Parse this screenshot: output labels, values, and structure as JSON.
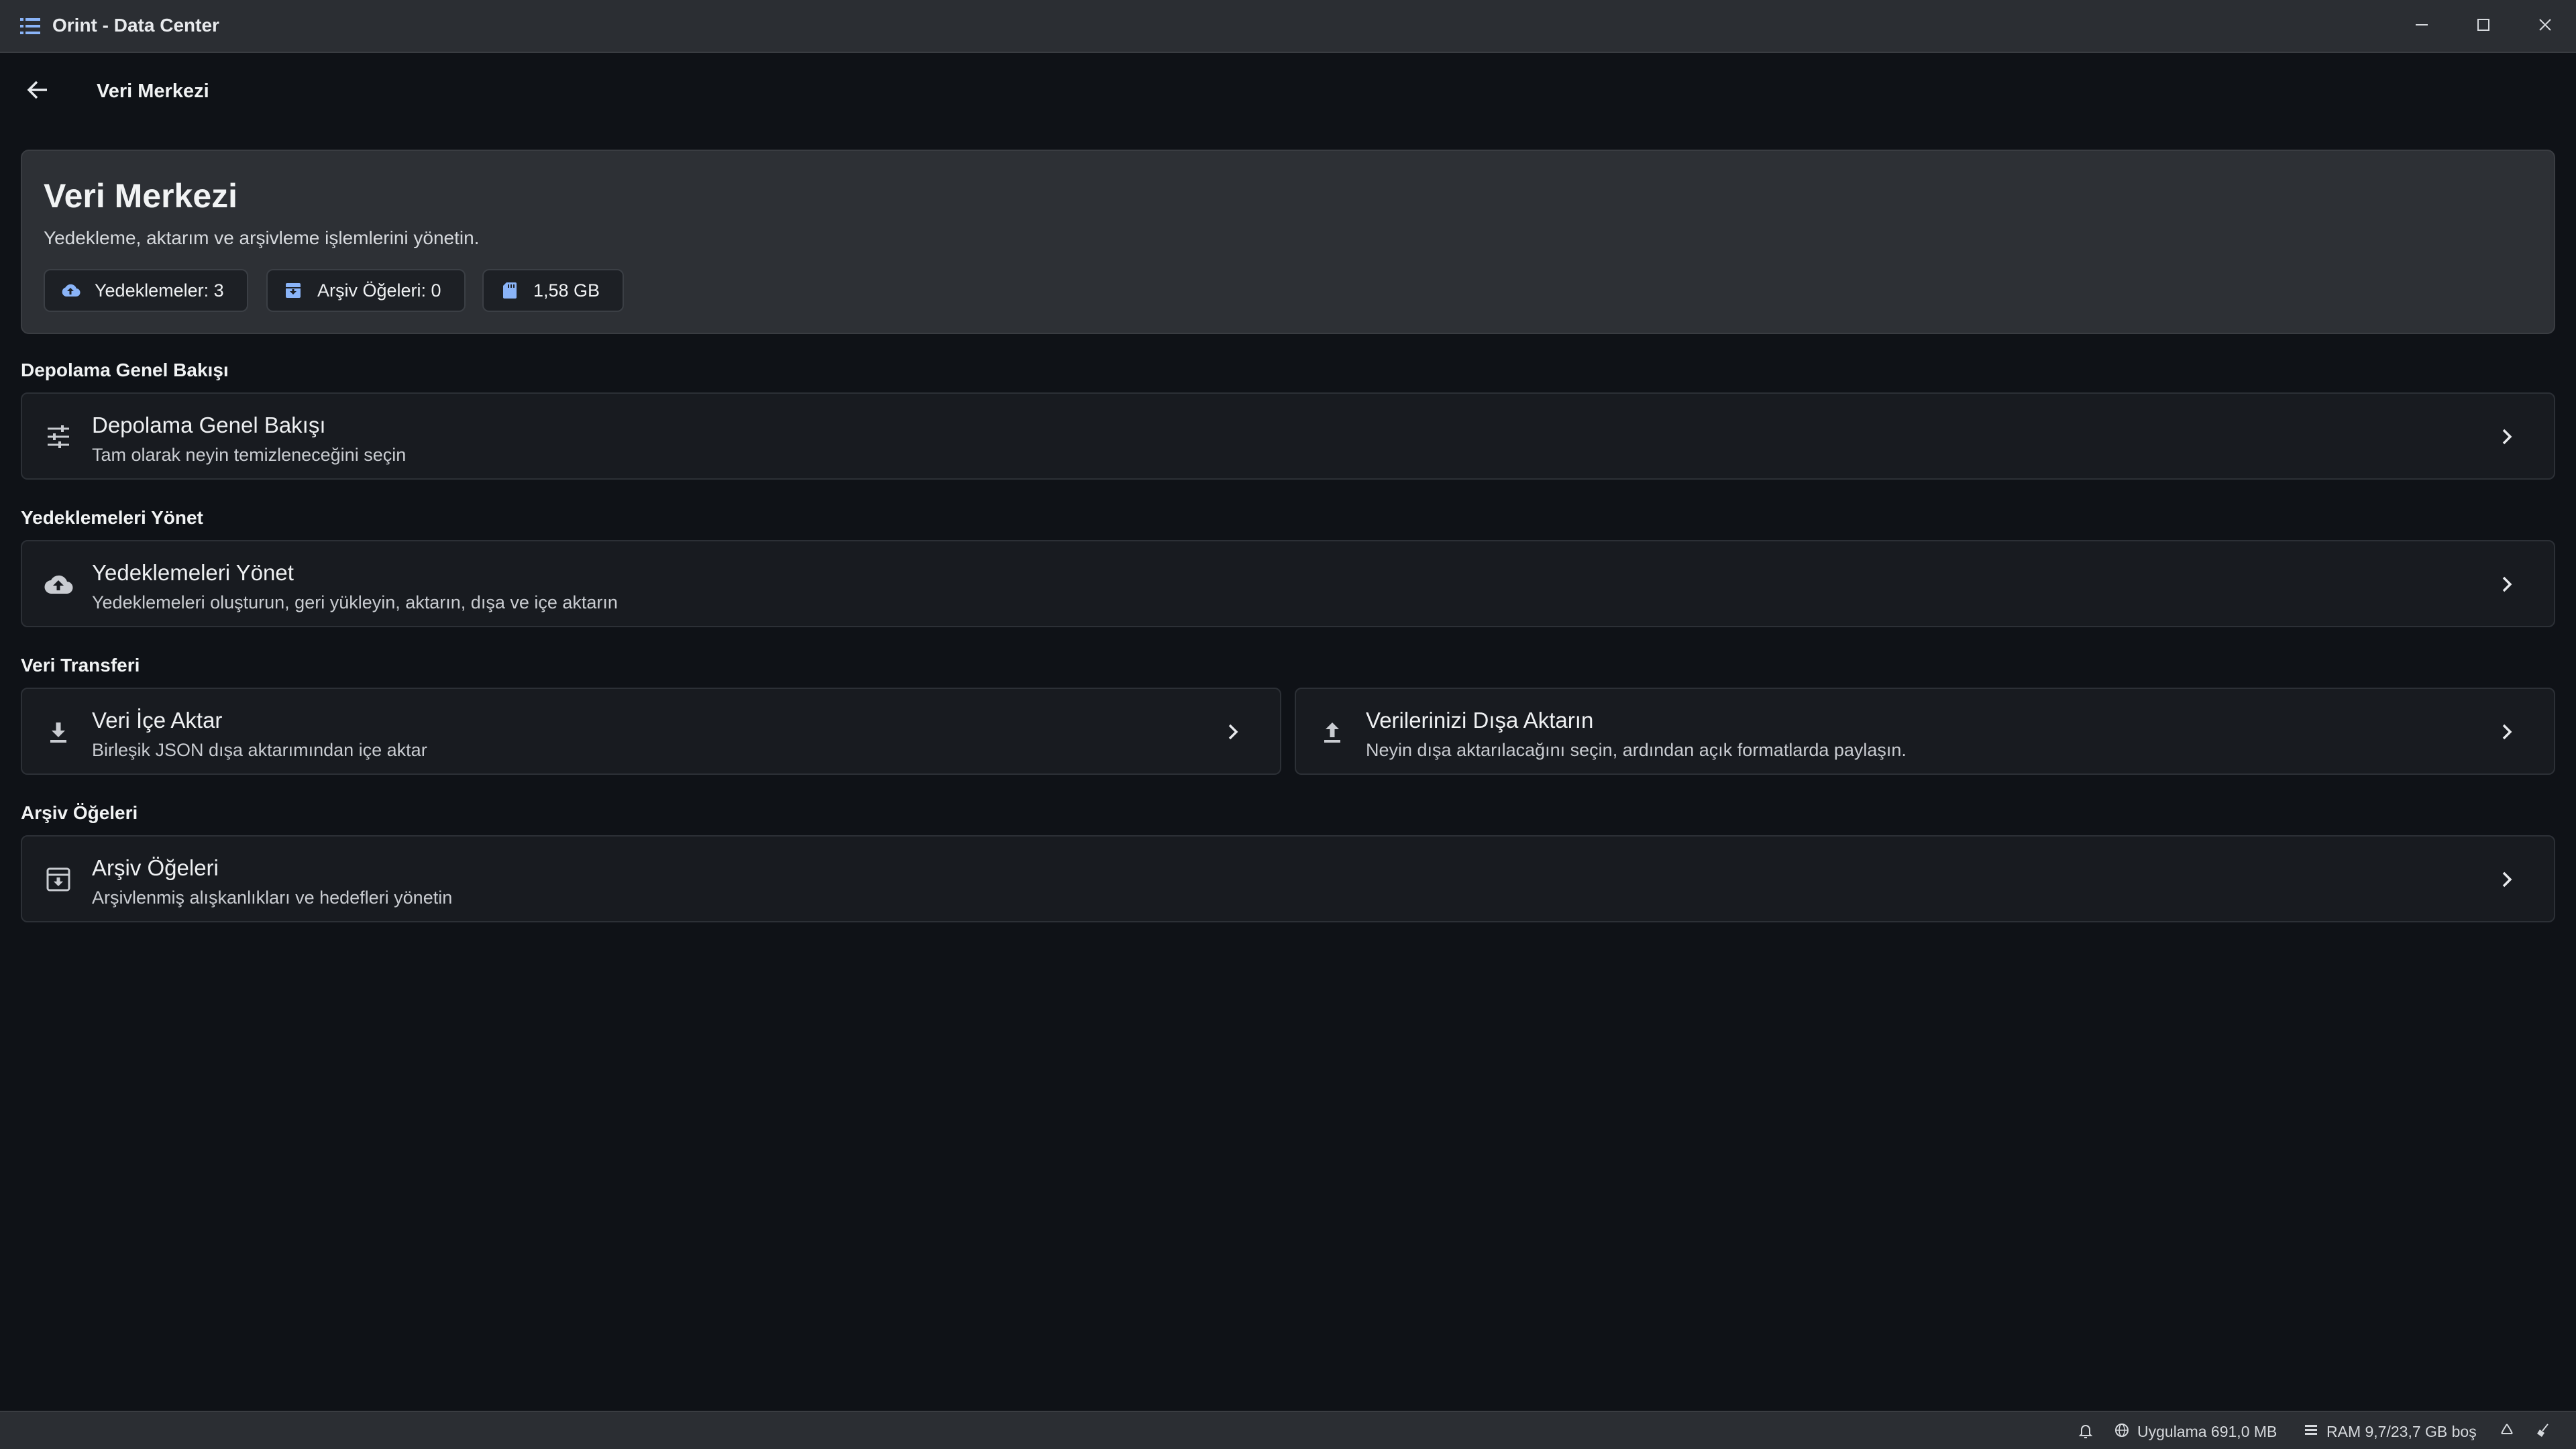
{
  "window": {
    "title": "Orint - Data Center",
    "icons": {
      "app": "list-icon",
      "minimize": "minimize-icon",
      "maximize": "maximize-icon",
      "close": "close-icon"
    }
  },
  "nav": {
    "title": "Veri Merkezi",
    "back_icon": "arrow-left-icon"
  },
  "hero": {
    "title": "Veri Merkezi",
    "subtitle": "Yedekleme, aktarım ve arşivleme işlemlerini yönetin.",
    "chips": [
      {
        "label": "Yedeklemeler: 3",
        "icon": "cloud-upload-icon"
      },
      {
        "label": "Arşiv Öğeleri: 0",
        "icon": "archive-icon"
      },
      {
        "label": "1,58 GB",
        "icon": "sd-card-icon"
      }
    ]
  },
  "sections": {
    "storage": {
      "heading": "Depolama Genel Bakışı",
      "card": {
        "title": "Depolama Genel Bakışı",
        "description": "Tam olarak neyin temizleneceğini seçin",
        "icon": "tune-sliders-icon"
      }
    },
    "backups": {
      "heading": "Yedeklemeleri Yönet",
      "card": {
        "title": "Yedeklemeleri Yönet",
        "description": "Yedeklemeleri oluşturun, geri yükleyin, aktarın, dışa ve içe aktarın",
        "icon": "cloud-upload-icon"
      }
    },
    "transfer": {
      "heading": "Veri Transferi",
      "import_card": {
        "title": "Veri İçe Aktar",
        "description": "Birleşik JSON dışa aktarımından içe aktar",
        "icon": "download-icon"
      },
      "export_card": {
        "title": "Verilerinizi Dışa Aktarın",
        "description": "Neyin dışa aktarılacağını seçin, ardından açık formatlarda paylaşın.",
        "icon": "upload-icon"
      }
    },
    "archive": {
      "heading": "Arşiv Öğeleri",
      "card": {
        "title": "Arşiv Öğeleri",
        "description": "Arşivlenmiş alışkanlıkları ve hedefleri yönetin",
        "icon": "archive-icon"
      }
    }
  },
  "statusbar": {
    "app_memory": "Uygulama 691,0 MB",
    "ram": "RAM 9,7/23,7 GB boş",
    "icons": {
      "notifications": "bell-icon",
      "app": "globe-icon",
      "ram": "memory-icon",
      "recycle": "recycle-icon",
      "clean": "broom-icon"
    }
  },
  "colors": {
    "background": "#0f1217",
    "titlebar": "#2b2e33",
    "hero": "#2d3035",
    "card": "#181b20",
    "chip_icon_accent": "#8ab4f8"
  }
}
